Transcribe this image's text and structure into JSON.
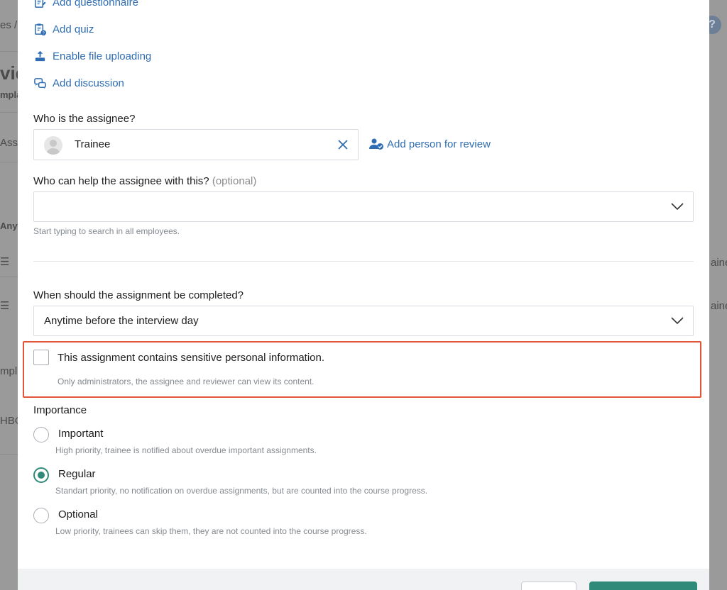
{
  "background": {
    "fragments": [
      "es /",
      "vie",
      "mpla",
      "Assi",
      "Anyti",
      "☰",
      "☰",
      "mpl",
      "HBO",
      "aine",
      "aine"
    ],
    "help_icon_glyph": "?"
  },
  "modal": {
    "actions": [
      {
        "label": "Add questionnaire",
        "icon": "questionnaire-icon"
      },
      {
        "label": "Add quiz",
        "icon": "quiz-icon"
      },
      {
        "label": "Enable file uploading",
        "icon": "upload-icon"
      },
      {
        "label": "Add discussion",
        "icon": "discussion-icon"
      }
    ],
    "assignee": {
      "question": "Who is the assignee?",
      "value": "Trainee",
      "add_reviewer_label": "Add person for review"
    },
    "helper": {
      "question": "Who can help the assignee with this?",
      "optional_tag": "(optional)",
      "value": "",
      "hint": "Start typing to search in all employees."
    },
    "completion": {
      "question": "When should the assignment be completed?",
      "value": "Anytime before the interview day"
    },
    "sensitive": {
      "checked": false,
      "label": "This assignment contains sensitive personal information.",
      "hint": "Only administrators, the assignee and reviewer can view its content."
    },
    "importance": {
      "label": "Importance",
      "selected": "Regular",
      "options": [
        {
          "label": "Important",
          "hint": "High priority, trainee is notified about overdue important assignments."
        },
        {
          "label": "Regular",
          "hint": "Standart priority, no notification on overdue assignments, but are counted into the course progress."
        },
        {
          "label": "Optional",
          "hint": "Low priority, trainees can skip them, they are not counted into the course progress."
        }
      ]
    }
  },
  "colors": {
    "link": "#2f6db2",
    "accent": "#2f8a79",
    "highlight_border": "#e2553a"
  }
}
